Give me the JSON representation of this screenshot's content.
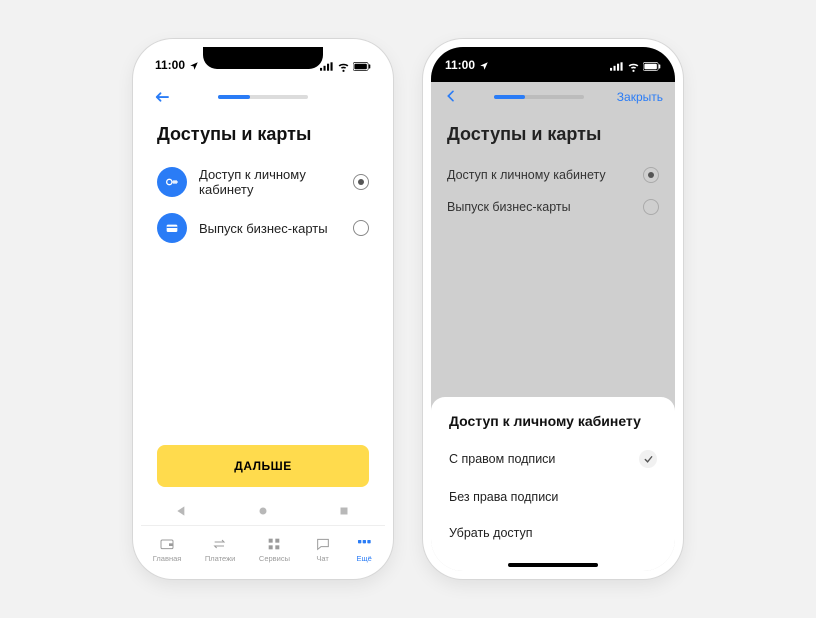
{
  "status": {
    "time": "11:00"
  },
  "progress": {
    "percent": 35
  },
  "left": {
    "title": "Доступы и карты",
    "options": [
      {
        "label": "Доступ к личному кабинету",
        "selected": true
      },
      {
        "label": "Выпуск бизнес-карты",
        "selected": false
      }
    ],
    "cta": "ДАЛЬШЕ",
    "tabs": [
      {
        "label": "Главная"
      },
      {
        "label": "Платежи"
      },
      {
        "label": "Сервисы"
      },
      {
        "label": "Чат"
      },
      {
        "label": "Ещё"
      }
    ]
  },
  "right": {
    "close": "Закрыть",
    "title": "Доступы и карты",
    "options": [
      {
        "label": "Доступ к личному кабинету",
        "selected": true
      },
      {
        "label": "Выпуск бизнес-карты",
        "selected": false
      }
    ],
    "sheet": {
      "title": "Доступ к личному кабинету",
      "items": [
        {
          "label": "С правом подписи",
          "checked": true
        },
        {
          "label": "Без права подписи",
          "checked": false
        },
        {
          "label": "Убрать доступ",
          "checked": false
        }
      ]
    }
  }
}
